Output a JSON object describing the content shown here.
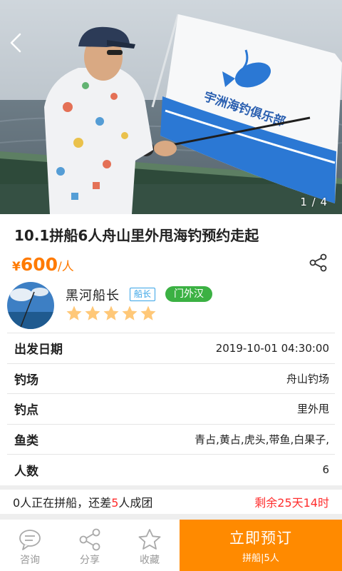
{
  "hero": {
    "page_indicator": "1 / 4",
    "flag_text": "宇洲海钓俱乐部"
  },
  "trip": {
    "title": "10.1拼船6人舟山里外甩海钓预约走起",
    "price_currency": "¥",
    "price_amount": "600",
    "price_unit": "/人"
  },
  "captain": {
    "name": "黑河船长",
    "role_badge": "船长",
    "level_badge": "门外汉",
    "rating": 5,
    "rating_max": 5
  },
  "details": [
    {
      "label": "出发日期",
      "value": "2019-10-01 04:30:00"
    },
    {
      "label": "钓场",
      "value": "舟山钓场"
    },
    {
      "label": "钓点",
      "value": "里外甩"
    },
    {
      "label": "鱼类",
      "value": "青占,黄占,虎头,带鱼,白果子,"
    },
    {
      "label": "人数",
      "value": "6"
    }
  ],
  "status": {
    "joined_prefix": "0人正在拼船，还差",
    "remaining_people": "5",
    "joined_suffix": "人成团",
    "time_left": "剩余25天14时"
  },
  "bottom_bar": {
    "consult_label": "咨询",
    "share_label": "分享",
    "favorite_label": "收藏",
    "book_label": "立即预订",
    "book_sub": "拼船|5人"
  },
  "colors": {
    "accent": "#ff8a00",
    "price": "#ff7a00",
    "alert": "#ff2d2d",
    "level_badge": "#3bb143",
    "role_badge": "#37a3e6",
    "star": "#ffc878"
  },
  "icons": {
    "back": "chevron-left-icon",
    "share": "share-icon",
    "consult": "chat-bubble-icon",
    "favorite": "star-outline-icon",
    "rating": "star-icon"
  }
}
